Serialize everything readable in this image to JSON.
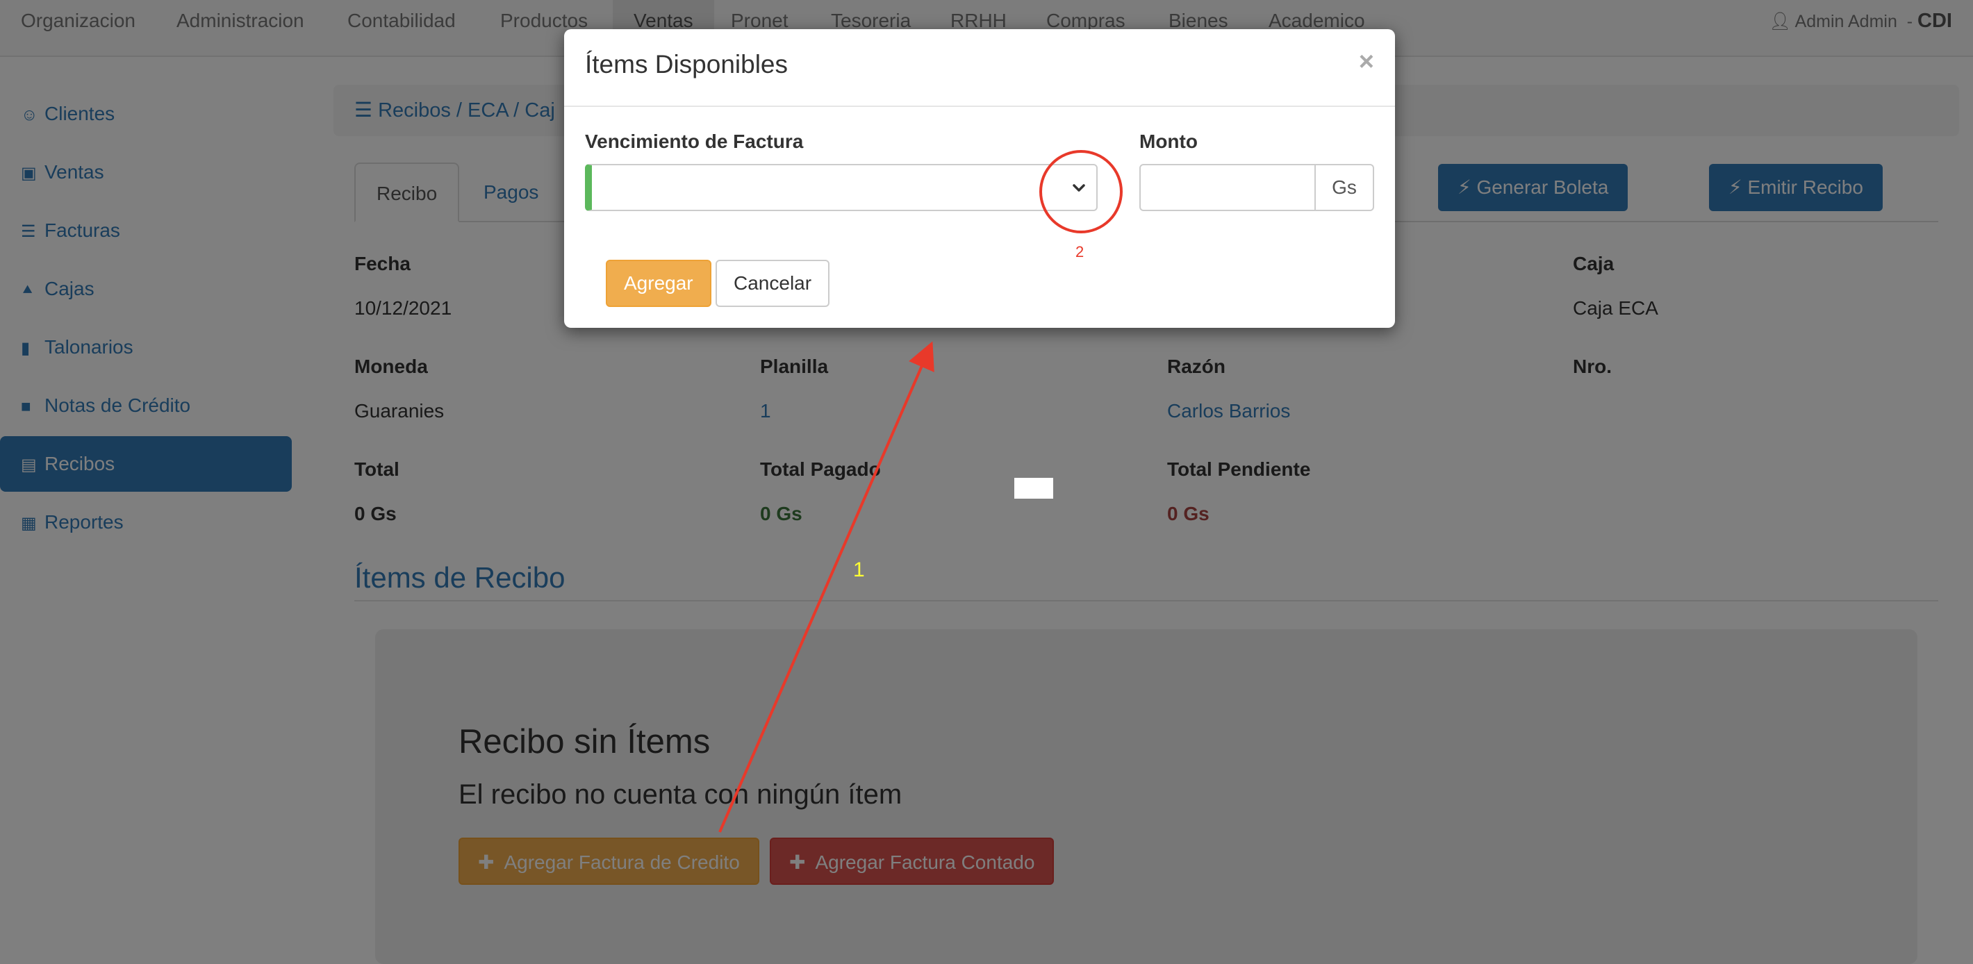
{
  "topnav": {
    "items": [
      "Organizacion",
      "Administracion",
      "Contabilidad",
      "Productos",
      "Ventas",
      "Pronet",
      "Tesoreria",
      "RRHH",
      "Compras",
      "Bienes",
      "Academico"
    ],
    "active": "Ventas",
    "user_name": "Admin Admin",
    "org": "CDI",
    "user_icon": "user-icon"
  },
  "sidebar": {
    "items": [
      {
        "label": "Clientes",
        "icon": "person-icon"
      },
      {
        "label": "Ventas",
        "icon": "money-icon"
      },
      {
        "label": "Facturas",
        "icon": "list-icon"
      },
      {
        "label": "Cajas",
        "icon": "cart-icon"
      },
      {
        "label": "Talonarios",
        "icon": "bookmark-icon"
      },
      {
        "label": "Notas de Crédito",
        "icon": "note-icon"
      },
      {
        "label": "Recibos",
        "icon": "newspaper-icon"
      },
      {
        "label": "Reportes",
        "icon": "calendar-icon"
      }
    ],
    "active": "Recibos"
  },
  "breadcrumb": {
    "items": [
      "Recibos",
      "ECA",
      "Caj"
    ],
    "separator": "/",
    "icon": "list-icon"
  },
  "tabs": [
    "Recibo",
    "Pagos"
  ],
  "actions": {
    "generar_boleta": "Generar Boleta",
    "emitir_recibo": "Emitir Recibo",
    "icon": "bolt-icon"
  },
  "details": {
    "fecha_label": "Fecha",
    "fecha_value": "10/12/2021",
    "caja_label": "Caja",
    "caja_value": "Caja ECA",
    "moneda_label": "Moneda",
    "moneda_value": "Guaranies",
    "planilla_label": "Planilla",
    "planilla_value": "1",
    "razon_label": "Razón",
    "razon_value": "Carlos Barrios",
    "nro_label": "Nro.",
    "total_label": "Total",
    "total_value": "0 Gs",
    "total_pagado_label": "Total Pagado",
    "total_pagado_value": "0 Gs",
    "total_pendiente_label": "Total Pendiente",
    "total_pendiente_value": "0 Gs"
  },
  "items_section": {
    "title": "Ítems de Recibo",
    "empty_title": "Recibo sin Ítems",
    "empty_subtitle": "El recibo no cuenta con ningún ítem",
    "btn_credito": "Agregar Factura de Credito",
    "btn_contado": "Agregar Factura Contado"
  },
  "modal": {
    "title": "Ítems Disponibles",
    "close": "×",
    "vencimiento_label": "Vencimiento de Factura",
    "vencimiento_value": "",
    "monto_label": "Monto",
    "monto_value": "",
    "currency": "Gs",
    "agregar": "Agregar",
    "cancelar": "Cancelar"
  },
  "annotations": {
    "step1": "1",
    "step2": "2",
    "color": "#e8392a"
  }
}
